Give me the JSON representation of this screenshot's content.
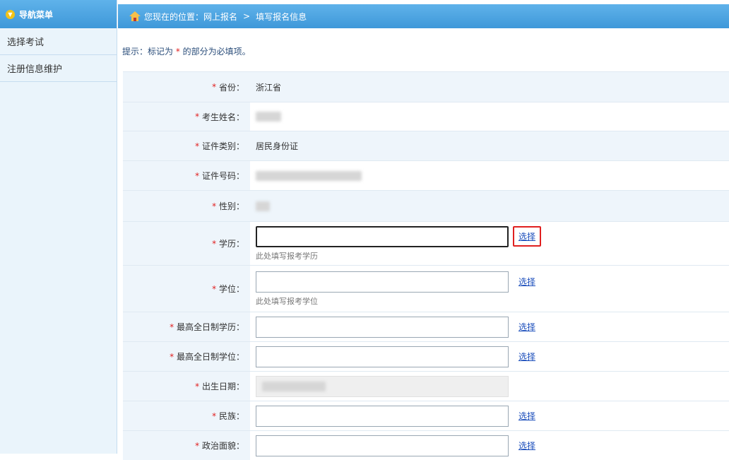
{
  "sidebar": {
    "header": "导航菜单",
    "items": [
      {
        "label": "选择考试"
      },
      {
        "label": "注册信息维护"
      }
    ]
  },
  "topbar": {
    "prefix": "您现在的位置：",
    "crumb1": "网上报名",
    "separator": ">",
    "crumb2": "填写报名信息"
  },
  "hint": {
    "text1": "提示：标记为",
    "star": "*",
    "text2": "的部分为必填项。"
  },
  "form": {
    "star": "*",
    "select_label": "选择",
    "rows": [
      {
        "label": "省份：",
        "value": "浙江省"
      },
      {
        "label": "考生姓名："
      },
      {
        "label": "证件类别：",
        "value": "居民身份证"
      },
      {
        "label": "证件号码："
      },
      {
        "label": "性别："
      },
      {
        "label": "学历：",
        "hint": "此处填写报考学历"
      },
      {
        "label": "学位：",
        "hint": "此处填写报考学位"
      },
      {
        "label": "最高全日制学历："
      },
      {
        "label": "最高全日制学位："
      },
      {
        "label": "出生日期："
      },
      {
        "label": "民族："
      },
      {
        "label": "政治面貌："
      }
    ]
  },
  "colors": {
    "header_blue": "#3e98d9",
    "required_red": "#e02020",
    "link_blue": "#1a4dbb"
  }
}
